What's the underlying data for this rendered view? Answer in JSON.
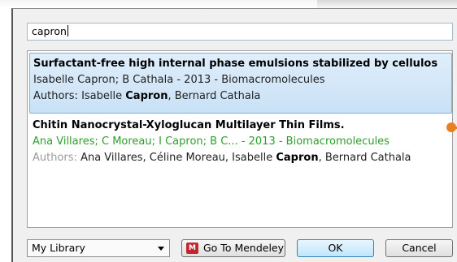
{
  "search": {
    "value": "capron"
  },
  "results": [
    {
      "title": "Surfactant-free high internal phase emulsions stabilized by cellulos",
      "meta": "Isabelle Capron; B Cathala - 2013 - Biomacromolecules",
      "authors_label": "Authors:",
      "authors_pre": "Isabelle",
      "authors_bold": "Capron",
      "authors_post": ", Bernard Cathala",
      "selected": true
    },
    {
      "title": "Chitin Nanocrystal-Xyloglucan Multilayer Thin Films.",
      "meta": "Ana Villares; C Moreau; I Capron; B C... - 2013 - Biomacromolecules",
      "authors_label": "Authors:",
      "authors_pre": "Ana Villares, Céline Moreau, Isabelle",
      "authors_bold": "Capron",
      "authors_post": ", Bernard Cathala",
      "selected": false
    }
  ],
  "footer": {
    "library_select": "My Library",
    "mendeley_button": "Go To Mendeley",
    "ok_button": "OK",
    "cancel_button": "Cancel"
  },
  "icons": {
    "mendeley": "mendeley-logo-icon",
    "dropdown": "chevron-down-icon"
  },
  "colors": {
    "selection_bg": "#cde3f8",
    "meta_green": "#2f9e2f",
    "accent_orange": "#e8801f",
    "mendeley_red": "#c0282d"
  }
}
